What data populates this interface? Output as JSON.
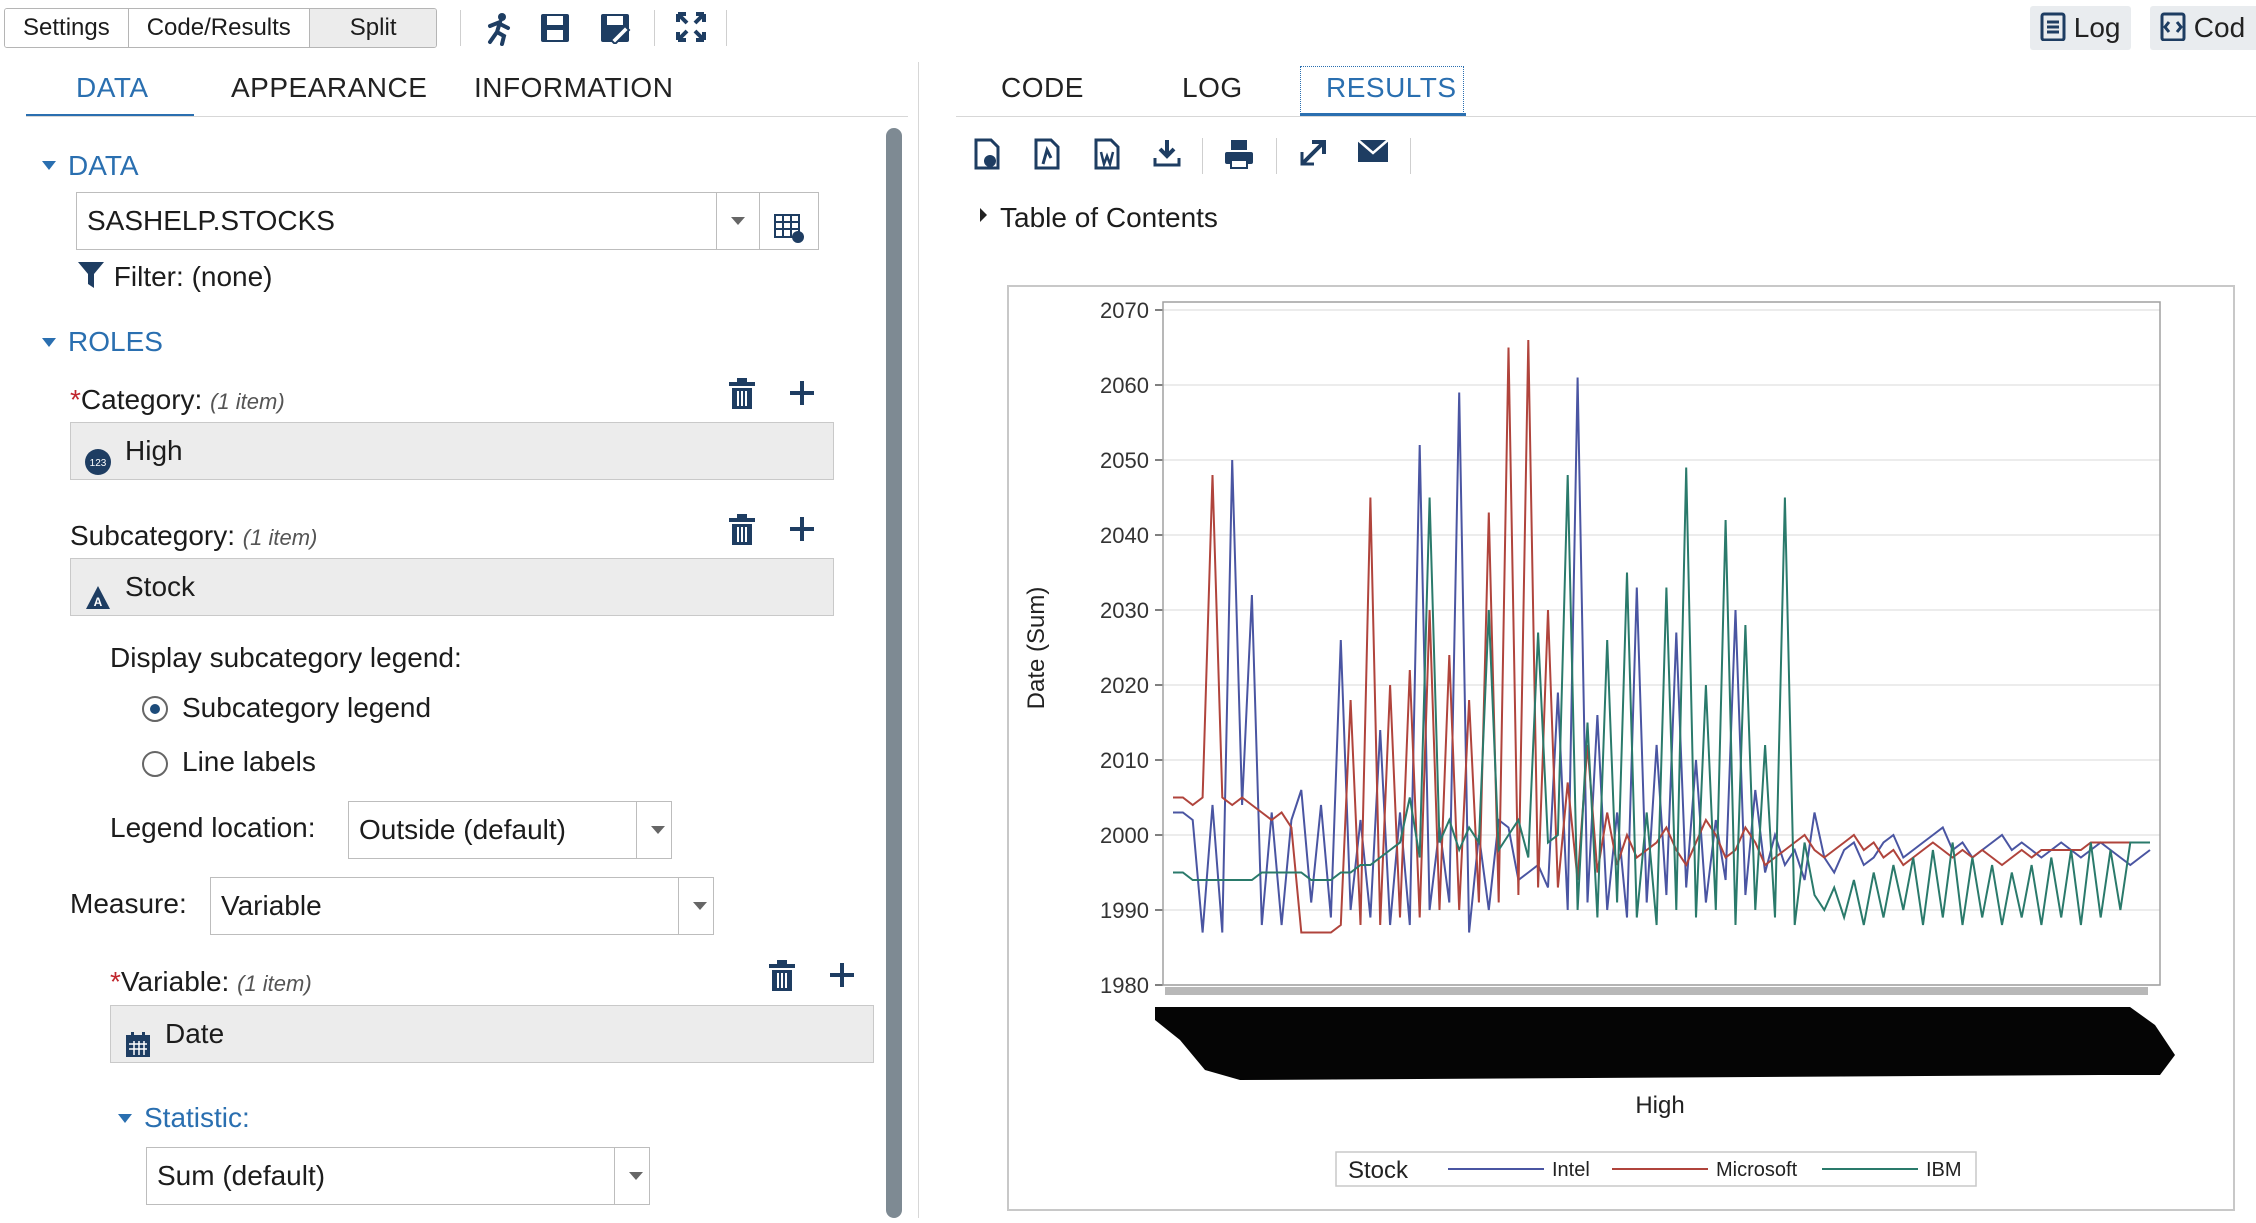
{
  "toolbar": {
    "segments": [
      "Settings",
      "Code/Results",
      "Split"
    ],
    "right_buttons": {
      "log": "Log",
      "code": "Cod"
    }
  },
  "left": {
    "tabs": [
      "DATA",
      "APPEARANCE",
      "INFORMATION"
    ],
    "data_section": "DATA",
    "dataset": "SASHELP.STOCKS",
    "filter_label": "Filter:",
    "filter_value": "(none)",
    "roles_section": "ROLES",
    "category": {
      "label": "Category:",
      "count": "(1 item)",
      "value": "High"
    },
    "subcategory": {
      "label": "Subcategory:",
      "count": "(1 item)",
      "value": "Stock"
    },
    "legend_display_label": "Display subcategory legend:",
    "legend_options": [
      "Subcategory legend",
      "Line labels"
    ],
    "legend_location_label": "Legend location:",
    "legend_location_value": "Outside (default)",
    "measure_label": "Measure:",
    "measure_value": "Variable",
    "variable": {
      "label": "Variable:",
      "count": "(1 item)",
      "value": "Date"
    },
    "statistic_label": "Statistic:",
    "statistic_value": "Sum (default)"
  },
  "right": {
    "tabs": [
      "CODE",
      "LOG",
      "RESULTS"
    ],
    "toc": "Table of Contents"
  },
  "chart_data": {
    "type": "line",
    "xlabel": "High",
    "ylabel": "Date (Sum)",
    "ylim": [
      1980,
      2070
    ],
    "yticks": [
      1980,
      1990,
      2000,
      2010,
      2020,
      2030,
      2040,
      2050,
      2060,
      2070
    ],
    "legend_title": "Stock",
    "legend_position": "bottom",
    "grid": true,
    "series": [
      {
        "name": "Intel",
        "color": "#4a55a2",
        "values": [
          2003,
          2003,
          2002,
          1987,
          2004,
          1987,
          2050,
          2004,
          2032,
          1988,
          2003,
          1988,
          2002,
          2006,
          1991,
          2004,
          1989,
          2026,
          1990,
          2002,
          1989,
          2014,
          1988,
          2003,
          1988,
          2052,
          1990,
          2001,
          1991,
          2059,
          1987,
          2000,
          1990,
          2002,
          2001,
          1994,
          1995,
          1996,
          1993,
          2019,
          1990,
          2061,
          1991,
          2016,
          1990,
          2003,
          1989,
          2033,
          1991,
          2012,
          1992,
          2027,
          1993,
          2010,
          1991,
          2002,
          1994,
          2030,
          1992,
          2006,
          1995,
          2000,
          1996,
          1998,
          1994,
          2003,
          1997,
          1995,
          1998,
          1999,
          1996,
          1997,
          1999,
          2000,
          1997,
          1998,
          1999,
          2000,
          2001,
          1998,
          1999,
          1997,
          1998,
          1999,
          2000,
          1998,
          1999,
          1998,
          1997,
          1998,
          1999,
          1998,
          1997,
          1998,
          1999,
          1998,
          1997,
          1996,
          1997,
          1998
        ]
      },
      {
        "name": "Microsoft",
        "color": "#b0443c",
        "values": [
          2005,
          2005,
          2004,
          2005,
          2048,
          2005,
          2004,
          2005,
          2004,
          2003,
          2002,
          2003,
          2001,
          1987,
          1987,
          1987,
          1987,
          1988,
          2018,
          1988,
          2045,
          1988,
          2020,
          1989,
          2022,
          1989,
          2030,
          1990,
          2024,
          1990,
          2018,
          1991,
          2043,
          1991,
          2065,
          1992,
          2066,
          1993,
          2030,
          1993,
          2007,
          1994,
          2012,
          1995,
          2003,
          1996,
          2000,
          1997,
          1998,
          1999,
          2001,
          1998,
          1996,
          1999,
          2002,
          2000,
          1997,
          1998,
          2001,
          1999,
          1996,
          1997,
          1998,
          1999,
          2000,
          1998,
          1997,
          1998,
          1999,
          2000,
          1998,
          1999,
          1997,
          1998,
          1996,
          1997,
          1998,
          1999,
          1998,
          1997,
          1998,
          1997,
          1998,
          1997,
          1996,
          1997,
          1998,
          1997,
          1998,
          1998,
          1998,
          1998,
          1998,
          1999,
          1999,
          1999,
          1999,
          1999,
          1999,
          1999
        ]
      },
      {
        "name": "IBM",
        "color": "#2a7a6b",
        "values": [
          1995,
          1995,
          1994,
          1994,
          1994,
          1994,
          1994,
          1994,
          1994,
          1995,
          1995,
          1995,
          1995,
          1995,
          1994,
          1994,
          1994,
          1995,
          1995,
          1996,
          1996,
          1997,
          1998,
          1999,
          2005,
          1997,
          2045,
          1999,
          2002,
          1998,
          2001,
          1999,
          2030,
          1998,
          2000,
          2002,
          1997,
          2027,
          1999,
          2000,
          2048,
          1990,
          2015,
          1989,
          2026,
          1991,
          2035,
          1989,
          2003,
          1988,
          2033,
          1990,
          2049,
          1989,
          2020,
          1990,
          2042,
          1988,
          2028,
          1990,
          2012,
          1989,
          2045,
          1988,
          1999,
          1992,
          1990,
          1993,
          1989,
          1994,
          1988,
          1995,
          1989,
          1996,
          1990,
          1997,
          1988,
          1998,
          1989,
          1999,
          1988,
          1997,
          1989,
          1996,
          1988,
          1995,
          1989,
          1996,
          1988,
          1997,
          1989,
          1998,
          1988,
          1999,
          1989,
          1998,
          1990,
          1999,
          1999,
          1999
        ]
      }
    ]
  }
}
